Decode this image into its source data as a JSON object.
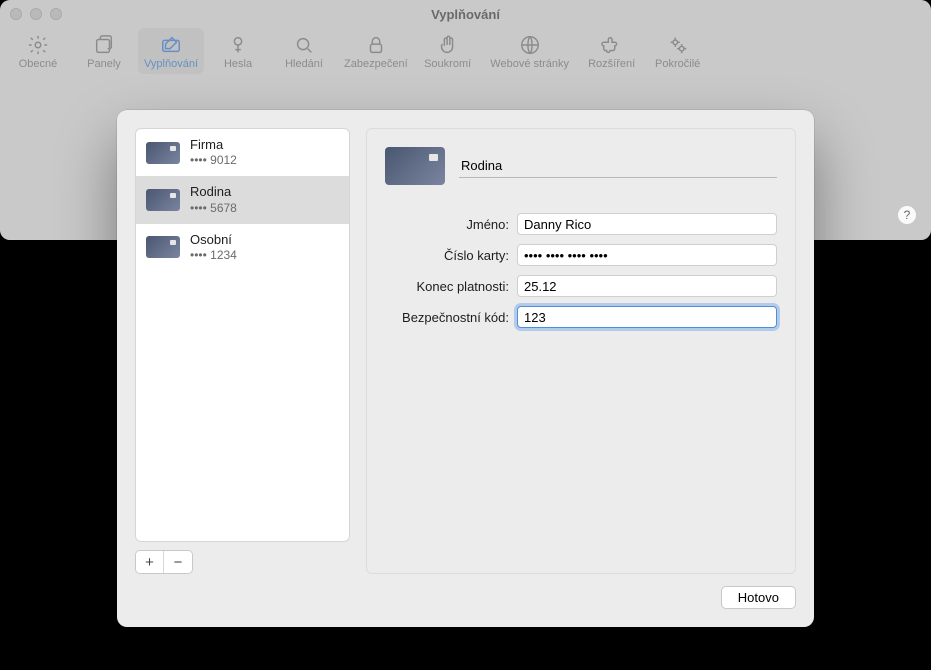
{
  "window": {
    "title": "Vyplňování"
  },
  "toolbar": {
    "items": [
      {
        "label": "Obecné"
      },
      {
        "label": "Panely"
      },
      {
        "label": "Vyplňování"
      },
      {
        "label": "Hesla"
      },
      {
        "label": "Hledání"
      },
      {
        "label": "Zabezpečení"
      },
      {
        "label": "Soukromí"
      },
      {
        "label": "Webové stránky"
      },
      {
        "label": "Rozšíření"
      },
      {
        "label": "Pokročilé"
      }
    ]
  },
  "help": {
    "glyph": "?"
  },
  "cards": [
    {
      "name": "Firma",
      "digits": "•••• 9012"
    },
    {
      "name": "Rodina",
      "digits": "•••• 5678"
    },
    {
      "name": "Osobní",
      "digits": "•••• 1234"
    }
  ],
  "addremove": {
    "add": "+",
    "remove": "−"
  },
  "detail": {
    "description": "Rodina",
    "labels": {
      "name": "Jméno:",
      "number": "Číslo karty:",
      "expiry": "Konec platnosti:",
      "security": "Bezpečnostní kód:"
    },
    "values": {
      "name": "Danny Rico",
      "number": "•••• •••• •••• ••••",
      "expiry": "25.12",
      "security": "123"
    }
  },
  "buttons": {
    "done": "Hotovo"
  }
}
